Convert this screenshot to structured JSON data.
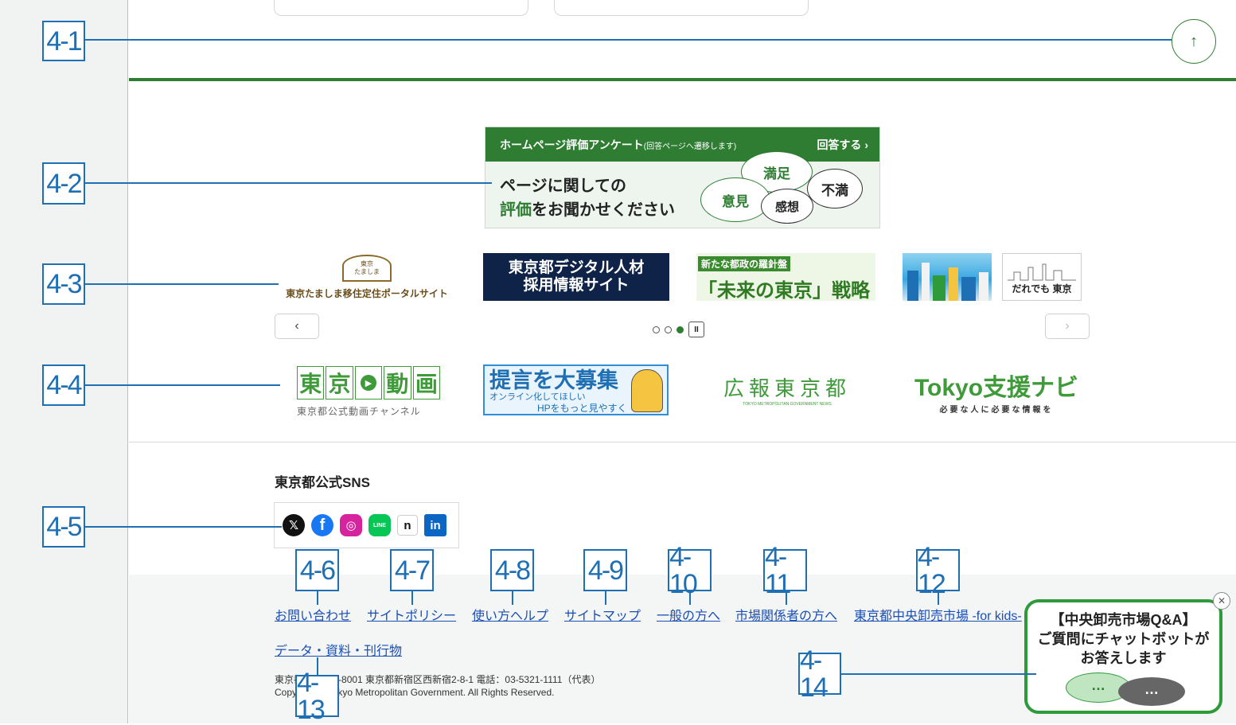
{
  "annotations": {
    "a1": "4-1",
    "a2": "4-2",
    "a3": "4-3",
    "a4": "4-4",
    "a5": "4-5",
    "a6": "4-6",
    "a7": "4-7",
    "a8": "4-8",
    "a9": "4-9",
    "a10": "4-10",
    "a11": "4-11",
    "a12": "4-12",
    "a13": "4-13",
    "a14": "4-14"
  },
  "back_to_top": {
    "icon": "↑"
  },
  "survey": {
    "title": "ホームページ評価アンケート",
    "title_note": "(回答ページへ遷移します)",
    "answer": "回答する ›",
    "line1": "ページに関しての",
    "line2_green": "評価",
    "line2_rest": "をお聞かせください",
    "bubble_satisfied": "満足",
    "bubble_opinion": "意見",
    "bubble_dissatisfied": "不満",
    "bubble_impression": "感想"
  },
  "banners": {
    "tamashima_house": "東京\nたましま",
    "tamashima_text": "東京たましま移住定住ポータルサイト",
    "digital_line1": "東京都デジタル人材",
    "digital_line2": "採用情報サイト",
    "future_tag": "新たな都政の羅針盤",
    "future_main": "「未来の東京」戦略",
    "daredemo": "だれでも 東京"
  },
  "carousel": {
    "prev": "‹",
    "next": "›",
    "pause": "II"
  },
  "banners2": {
    "douga_1": "東",
    "douga_2": "京",
    "douga_4": "動",
    "douga_5": "画",
    "douga_sub": "東京都公式動画チャンネル",
    "teigen_main": "提言を大募集",
    "teigen_sub1": "オンライン化してほしい",
    "teigen_sub2": "HPをもっと見やすく",
    "kouhou": "広報東京都",
    "kouhou_sub": "TOKYO METROPOLITAN GOVERNMENT NEWS",
    "navi": "Tokyo支援ナビ",
    "navi_sub": "必要な人に必要な情報を"
  },
  "sns": {
    "heading": "東京都公式SNS",
    "x": "𝕏",
    "facebook": "f",
    "instagram": "◎",
    "line": "LINE",
    "note": "n",
    "linkedin": "in"
  },
  "footer": {
    "contact": "お問い合わせ",
    "policy": "サイトポリシー",
    "help": "使い方ヘルプ",
    "sitemap": "サイトマップ",
    "general": "一般の方へ",
    "market": "市場関係者の方へ",
    "kids": "東京都中央卸売市場 -for kids-",
    "data": "データ・資料・刊行物",
    "address": "東京都　〒163-8001 東京都新宿区西新宿2-8-1 電話：03-5321-1111（代表）",
    "copyright": "Copyright © Tokyo Metropolitan Government. All Rights Reserved."
  },
  "chatbot": {
    "line1": "【中央卸売市場Q&A】",
    "line2": "ご質問にチャットボットが",
    "line3": "お答えします",
    "dots": "…",
    "close": "✕"
  }
}
